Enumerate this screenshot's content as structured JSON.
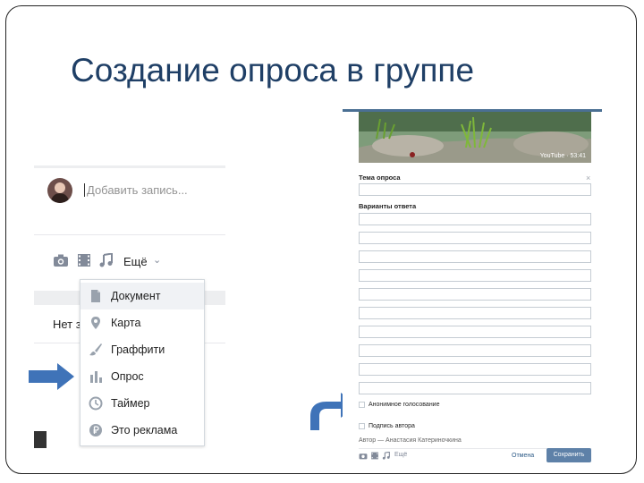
{
  "slide": {
    "title": "Создание опроса в группе"
  },
  "left_screenshot": {
    "post_placeholder": "Добавить запись...",
    "more_label": "Ещё",
    "tab_label": "Нет з",
    "toolbar_icons": [
      "camera-icon",
      "film-icon",
      "music-icon"
    ],
    "dropdown": {
      "items": [
        {
          "label": "Документ",
          "icon": "document-icon",
          "active": true
        },
        {
          "label": "Карта",
          "icon": "map-pin-icon",
          "active": false
        },
        {
          "label": "Граффити",
          "icon": "brush-icon",
          "active": false
        },
        {
          "label": "Опрос",
          "icon": "poll-chart-icon",
          "active": false
        },
        {
          "label": "Таймер",
          "icon": "clock-icon",
          "active": false
        },
        {
          "label": "Это реклама",
          "icon": "ruble-icon",
          "active": false
        }
      ]
    }
  },
  "right_screenshot": {
    "video_badge": "YouTube · 53:41",
    "topic_label": "Тема опроса",
    "options_label": "Варианты ответа",
    "option_count": 10,
    "anonymous_label": "Анонимное голосование",
    "signature_label": "Подпись автора",
    "author_text": "Автор — Анастасия Катериночкина",
    "more_label": "Ещё",
    "cancel_label": "Отмена",
    "save_label": "Сохранить"
  },
  "colors": {
    "title": "#1f3f66",
    "arrow": "#3f73b8",
    "accent_button": "#5e81a8",
    "link": "#2a5885"
  }
}
